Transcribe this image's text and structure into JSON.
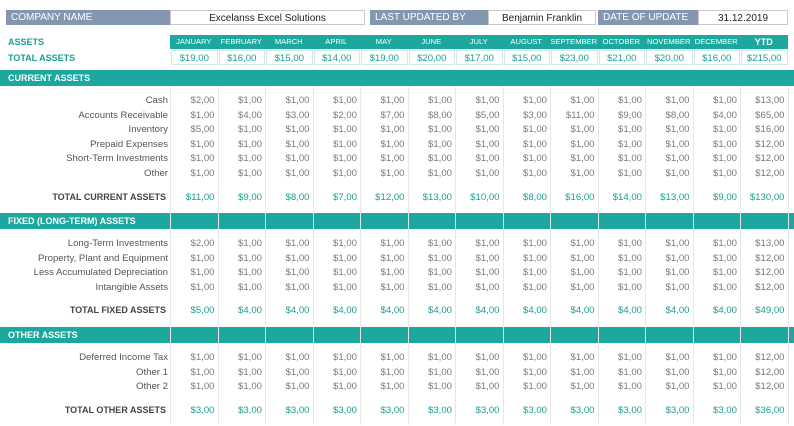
{
  "header": {
    "company_label": "COMPANY NAME",
    "company_value": "Excelanss Excel Solutions",
    "updated_by_label": "LAST UPDATED BY",
    "updated_by_value": "Benjamin Franklin",
    "date_label": "DATE OF UPDATE",
    "date_value": "31.12.2019"
  },
  "summary": {
    "assets_label": "ASSETS",
    "total_assets_label": "TOTAL ASSETS",
    "months": [
      "JANUARY",
      "FEBRUARY",
      "MARCH",
      "APRIL",
      "MAY",
      "JUNE",
      "JULY",
      "AUGUST",
      "SEPTEMBER",
      "OCTOBER",
      "NOVEMBER",
      "DECEMBER",
      "YTD"
    ],
    "total_assets": [
      "$19,00",
      "$16,00",
      "$15,00",
      "$14,00",
      "$19,00",
      "$20,00",
      "$17,00",
      "$15,00",
      "$23,00",
      "$21,00",
      "$20,00",
      "$16,00",
      "$215,00"
    ]
  },
  "sections": [
    {
      "title": "CURRENT ASSETS",
      "rows": [
        {
          "label": "Cash",
          "values": [
            "$2,00",
            "$1,00",
            "$1,00",
            "$1,00",
            "$1,00",
            "$1,00",
            "$1,00",
            "$1,00",
            "$1,00",
            "$1,00",
            "$1,00",
            "$1,00",
            "$13,00"
          ]
        },
        {
          "label": "Accounts Receivable",
          "values": [
            "$1,00",
            "$4,00",
            "$3,00",
            "$2,00",
            "$7,00",
            "$8,00",
            "$5,00",
            "$3,00",
            "$11,00",
            "$9,00",
            "$8,00",
            "$4,00",
            "$65,00"
          ]
        },
        {
          "label": "Inventory",
          "values": [
            "$5,00",
            "$1,00",
            "$1,00",
            "$1,00",
            "$1,00",
            "$1,00",
            "$1,00",
            "$1,00",
            "$1,00",
            "$1,00",
            "$1,00",
            "$1,00",
            "$16,00"
          ]
        },
        {
          "label": "Prepaid Expenses",
          "values": [
            "$1,00",
            "$1,00",
            "$1,00",
            "$1,00",
            "$1,00",
            "$1,00",
            "$1,00",
            "$1,00",
            "$1,00",
            "$1,00",
            "$1,00",
            "$1,00",
            "$12,00"
          ]
        },
        {
          "label": "Short-Term Investments",
          "values": [
            "$1,00",
            "$1,00",
            "$1,00",
            "$1,00",
            "$1,00",
            "$1,00",
            "$1,00",
            "$1,00",
            "$1,00",
            "$1,00",
            "$1,00",
            "$1,00",
            "$12,00"
          ]
        },
        {
          "label": "Other",
          "values": [
            "$1,00",
            "$1,00",
            "$1,00",
            "$1,00",
            "$1,00",
            "$1,00",
            "$1,00",
            "$1,00",
            "$1,00",
            "$1,00",
            "$1,00",
            "$1,00",
            "$12,00"
          ]
        }
      ],
      "total_label": "TOTAL CURRENT ASSETS",
      "totals": [
        "$11,00",
        "$9,00",
        "$8,00",
        "$7,00",
        "$12,00",
        "$13,00",
        "$10,00",
        "$8,00",
        "$16,00",
        "$14,00",
        "$13,00",
        "$9,00",
        "$130,00"
      ]
    },
    {
      "title": "FIXED (LONG-TERM) ASSETS",
      "rows": [
        {
          "label": "Long-Term Investments",
          "values": [
            "$2,00",
            "$1,00",
            "$1,00",
            "$1,00",
            "$1,00",
            "$1,00",
            "$1,00",
            "$1,00",
            "$1,00",
            "$1,00",
            "$1,00",
            "$1,00",
            "$13,00"
          ]
        },
        {
          "label": "Property, Plant and Equipment",
          "values": [
            "$1,00",
            "$1,00",
            "$1,00",
            "$1,00",
            "$1,00",
            "$1,00",
            "$1,00",
            "$1,00",
            "$1,00",
            "$1,00",
            "$1,00",
            "$1,00",
            "$12,00"
          ]
        },
        {
          "label": "Less Accumulated Depreciation",
          "values": [
            "$1,00",
            "$1,00",
            "$1,00",
            "$1,00",
            "$1,00",
            "$1,00",
            "$1,00",
            "$1,00",
            "$1,00",
            "$1,00",
            "$1,00",
            "$1,00",
            "$12,00"
          ]
        },
        {
          "label": "Intangible Assets",
          "values": [
            "$1,00",
            "$1,00",
            "$1,00",
            "$1,00",
            "$1,00",
            "$1,00",
            "$1,00",
            "$1,00",
            "$1,00",
            "$1,00",
            "$1,00",
            "$1,00",
            "$12,00"
          ]
        }
      ],
      "total_label": "TOTAL FIXED ASSETS",
      "totals": [
        "$5,00",
        "$4,00",
        "$4,00",
        "$4,00",
        "$4,00",
        "$4,00",
        "$4,00",
        "$4,00",
        "$4,00",
        "$4,00",
        "$4,00",
        "$4,00",
        "$49,00"
      ]
    },
    {
      "title": "OTHER ASSETS",
      "rows": [
        {
          "label": "Deferred Income Tax",
          "values": [
            "$1,00",
            "$1,00",
            "$1,00",
            "$1,00",
            "$1,00",
            "$1,00",
            "$1,00",
            "$1,00",
            "$1,00",
            "$1,00",
            "$1,00",
            "$1,00",
            "$12,00"
          ]
        },
        {
          "label": "Other 1",
          "values": [
            "$1,00",
            "$1,00",
            "$1,00",
            "$1,00",
            "$1,00",
            "$1,00",
            "$1,00",
            "$1,00",
            "$1,00",
            "$1,00",
            "$1,00",
            "$1,00",
            "$12,00"
          ]
        },
        {
          "label": "Other 2",
          "values": [
            "$1,00",
            "$1,00",
            "$1,00",
            "$1,00",
            "$1,00",
            "$1,00",
            "$1,00",
            "$1,00",
            "$1,00",
            "$1,00",
            "$1,00",
            "$1,00",
            "$12,00"
          ]
        }
      ],
      "total_label": "TOTAL OTHER ASSETS",
      "totals": [
        "$3,00",
        "$3,00",
        "$3,00",
        "$3,00",
        "$3,00",
        "$3,00",
        "$3,00",
        "$3,00",
        "$3,00",
        "$3,00",
        "$3,00",
        "$3,00",
        "$36,00"
      ]
    }
  ],
  "colors": {
    "accent": "#1ca89e",
    "header_label_bg": "#8497b0",
    "accent_text": "#1a9e94"
  }
}
